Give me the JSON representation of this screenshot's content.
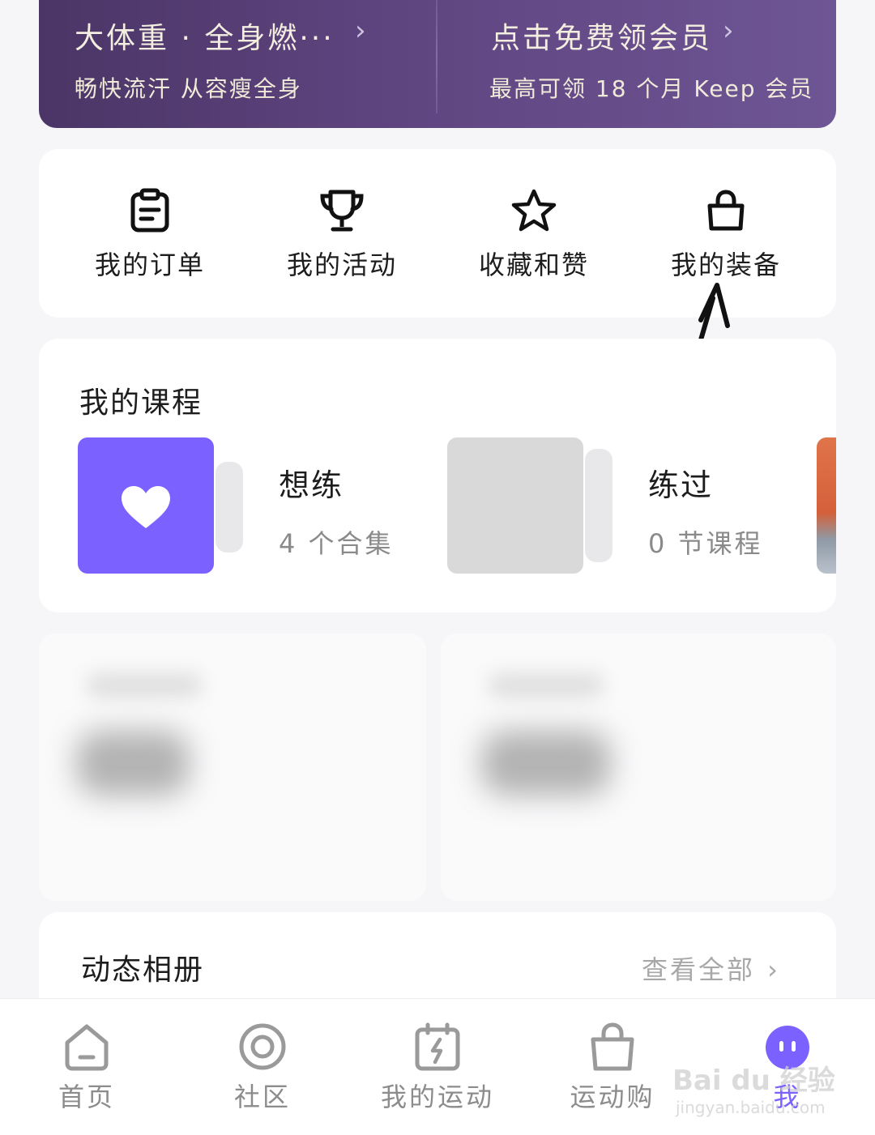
{
  "promo": {
    "left_title": "大体重 · 全身燃···",
    "left_subtitle": "畅快流汗 从容瘦全身",
    "right_title": "点击免费领会员",
    "right_subtitle": "最高可领 18 个月 Keep 会员",
    "chevron": "›"
  },
  "quick_actions": [
    {
      "label": "我的订单",
      "icon": "order-clipboard-icon"
    },
    {
      "label": "我的活动",
      "icon": "trophy-icon"
    },
    {
      "label": "收藏和赞",
      "icon": "star-icon"
    },
    {
      "label": "我的装备",
      "icon": "shopping-bag-icon"
    }
  ],
  "courses": {
    "title": "我的课程",
    "items": [
      {
        "name": "想练",
        "subtitle": "4 个合集",
        "icon": "heart-icon"
      },
      {
        "name": "练过",
        "subtitle": "0 节课程"
      }
    ]
  },
  "album": {
    "title": "动态相册",
    "see_all": "查看全部",
    "chevron": "›"
  },
  "tabbar": {
    "items": [
      {
        "label": "首页",
        "icon": "home-icon"
      },
      {
        "label": "社区",
        "icon": "community-ring-icon"
      },
      {
        "label": "我的运动",
        "icon": "calendar-bolt-icon"
      },
      {
        "label": "运动购",
        "icon": "shopping-bag-icon"
      },
      {
        "label": "我",
        "icon": "avatar-icon"
      }
    ],
    "active_color": "#7b61ff"
  },
  "watermark": {
    "logo": "Bai du 经验",
    "url": "jingyan.baidu.com"
  },
  "colors": {
    "accent": "#7b61ff",
    "banner": "#5f4580"
  }
}
